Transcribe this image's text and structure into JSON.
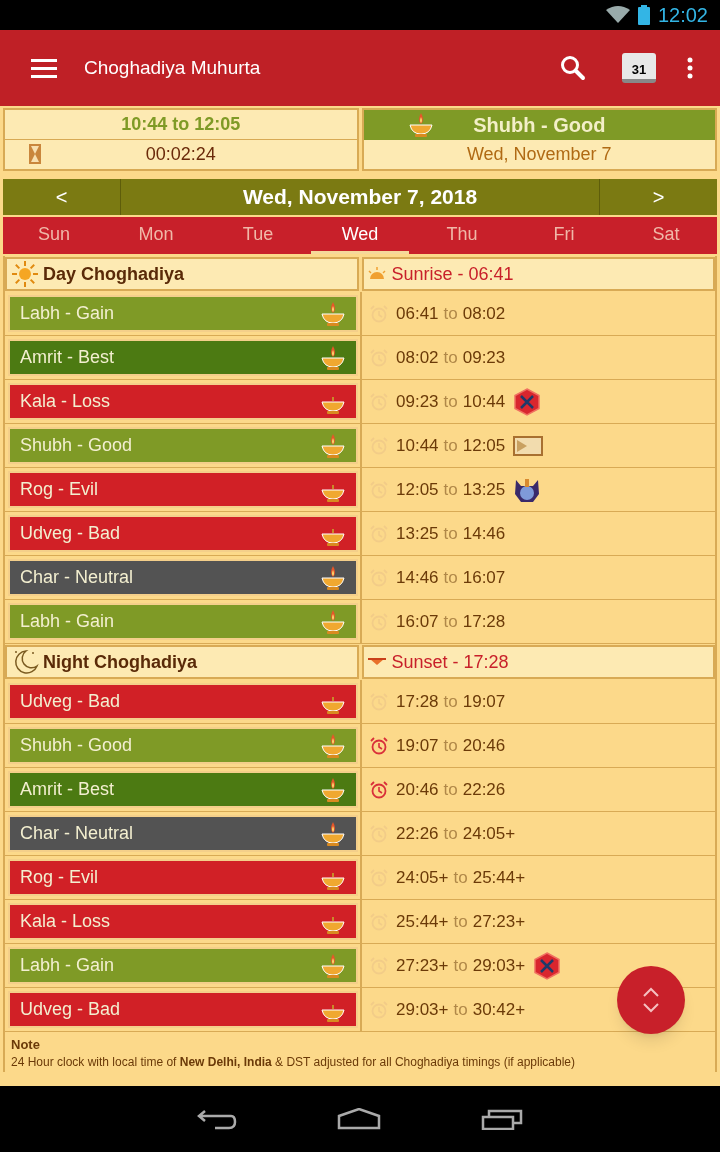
{
  "status_bar": {
    "time": "12:02"
  },
  "app_bar": {
    "title": "Choghadiya Muhurta",
    "calendar_day": "31"
  },
  "current": {
    "range": "10:44 to 12:05",
    "countdown": "00:02:24",
    "name": "Shubh - Good",
    "color": "#7f9a26",
    "date": "Wed, November 7"
  },
  "date_nav": {
    "prev": "<",
    "date": "Wed, November 7, 2018",
    "next": ">"
  },
  "tabs": [
    {
      "label": "Sun",
      "selected": false
    },
    {
      "label": "Mon",
      "selected": false
    },
    {
      "label": "Tue",
      "selected": false
    },
    {
      "label": "Wed",
      "selected": true
    },
    {
      "label": "Thu",
      "selected": false
    },
    {
      "label": "Fri",
      "selected": false
    },
    {
      "label": "Sat",
      "selected": false
    }
  ],
  "sections": [
    {
      "kind": "day",
      "title": "Day Choghadiya",
      "event": "Sunrise - 06:41",
      "rows": [
        {
          "kind": "plain",
          "name": "Labh - Gain",
          "color": "#7f9a26",
          "lit": true,
          "start": "06:41",
          "sep": "to",
          "end": "08:02",
          "alarm_on": false
        },
        {
          "kind": "plain",
          "name": "Amrit - Best",
          "color": "#4c7a12",
          "lit": true,
          "start": "08:02",
          "sep": "to",
          "end": "09:23",
          "alarm_on": false
        },
        {
          "kind": "hexagon",
          "name": "Kala - Loss",
          "color": "#d12026",
          "lit": false,
          "start": "09:23",
          "sep": "to",
          "end": "10:44",
          "alarm_on": false
        },
        {
          "kind": "hourglass",
          "name": "Shubh - Good",
          "color": "#7f9a26",
          "lit": true,
          "start": "10:44",
          "sep": "to",
          "end": "12:05",
          "alarm_on": false
        },
        {
          "kind": "figure",
          "name": "Rog - Evil",
          "color": "#d12026",
          "lit": false,
          "start": "12:05",
          "sep": "to",
          "end": "13:25",
          "alarm_on": false
        },
        {
          "kind": "plain",
          "name": "Udveg - Bad",
          "color": "#d12026",
          "lit": false,
          "start": "13:25",
          "sep": "to",
          "end": "14:46",
          "alarm_on": false
        },
        {
          "kind": "plain",
          "name": "Char - Neutral",
          "color": "#535353",
          "lit": true,
          "start": "14:46",
          "sep": "to",
          "end": "16:07",
          "alarm_on": false
        },
        {
          "kind": "plain",
          "name": "Labh - Gain",
          "color": "#7f9a26",
          "lit": true,
          "start": "16:07",
          "sep": "to",
          "end": "17:28",
          "alarm_on": false
        }
      ]
    },
    {
      "kind": "night",
      "title": "Night Choghadiya",
      "event": "Sunset - 17:28",
      "rows": [
        {
          "kind": "plain",
          "name": "Udveg - Bad",
          "color": "#d12026",
          "lit": false,
          "start": "17:28",
          "sep": "to",
          "end": "19:07",
          "alarm_on": false
        },
        {
          "kind": "plain",
          "name": "Shubh - Good",
          "color": "#7f9a26",
          "lit": true,
          "start": "19:07",
          "sep": "to",
          "end": "20:46",
          "alarm_on": true
        },
        {
          "kind": "plain",
          "name": "Amrit - Best",
          "color": "#4c7a12",
          "lit": true,
          "start": "20:46",
          "sep": "to",
          "end": "22:26",
          "alarm_on": true
        },
        {
          "kind": "plain",
          "name": "Char - Neutral",
          "color": "#535353",
          "lit": true,
          "start": "22:26",
          "sep": "to",
          "end": "24:05+",
          "alarm_on": false
        },
        {
          "kind": "plain",
          "name": "Rog - Evil",
          "color": "#d12026",
          "lit": false,
          "start": "24:05+",
          "sep": "to",
          "end": "25:44+",
          "alarm_on": false
        },
        {
          "kind": "plain",
          "name": "Kala - Loss",
          "color": "#d12026",
          "lit": false,
          "start": "25:44+",
          "sep": "to",
          "end": "27:23+",
          "alarm_on": false
        },
        {
          "kind": "hexagon",
          "name": "Labh - Gain",
          "color": "#7f9a26",
          "lit": true,
          "start": "27:23+",
          "sep": "to",
          "end": "29:03+",
          "alarm_on": false
        },
        {
          "kind": "plain",
          "name": "Udveg - Bad",
          "color": "#d12026",
          "lit": false,
          "start": "29:03+",
          "sep": "to",
          "end": "30:42+",
          "alarm_on": false
        }
      ]
    }
  ],
  "note": {
    "title": "Note",
    "text": "24 Hour clock with local time of **New Delhi, India** & DST adjusted for all Choghadiya timings (if applicable)"
  }
}
